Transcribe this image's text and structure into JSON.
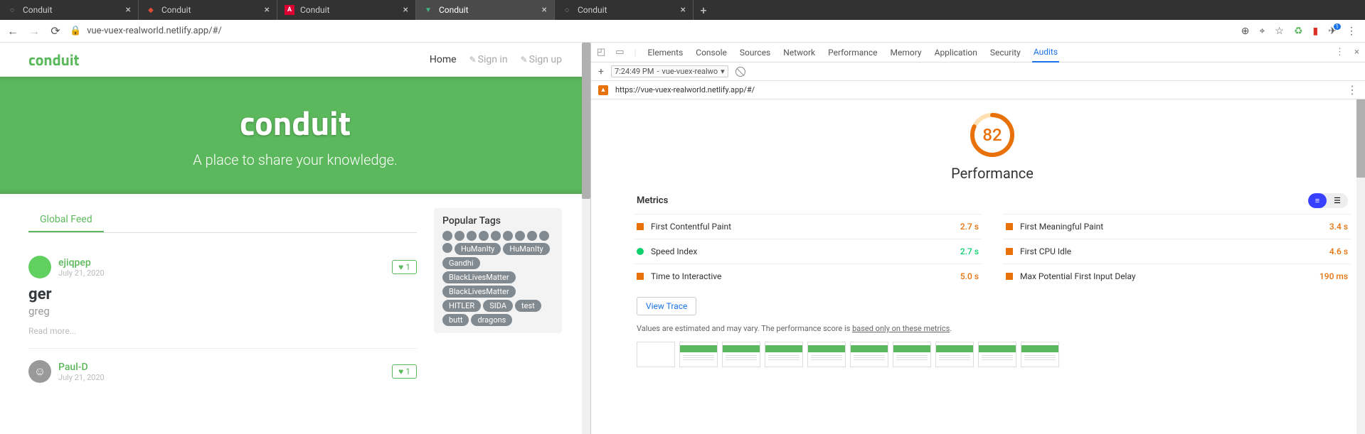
{
  "browser": {
    "tabs": [
      {
        "title": "Conduit",
        "favicon": "generic"
      },
      {
        "title": "Conduit",
        "favicon": "ember"
      },
      {
        "title": "Conduit",
        "favicon": "angular"
      },
      {
        "title": "Conduit",
        "favicon": "vue",
        "active": true
      },
      {
        "title": "Conduit",
        "favicon": "generic"
      }
    ],
    "url": "vue-vuex-realworld.netlify.app/#/"
  },
  "page": {
    "brand": "conduit",
    "nav": {
      "home": "Home",
      "signin": "Sign in",
      "signup": "Sign up"
    },
    "banner": {
      "title": "conduit",
      "subtitle": "A place to share your knowledge."
    },
    "feed_tab": "Global Feed",
    "articles": [
      {
        "author": "ejiqpep",
        "date": "July 21, 2020",
        "likes": "1",
        "title": "ger",
        "desc": "greg",
        "readmore": "Read more..."
      },
      {
        "author": "Paul-D",
        "date": "July 21, 2020",
        "likes": "1"
      }
    ],
    "tags": {
      "header": "Popular Tags",
      "blank_count": 10,
      "list": [
        "HuManIty",
        "HuManIty",
        "Gandhi",
        "BlackLivesMatter",
        "BlackLivesMatter",
        "HITLER",
        "SIDA",
        "test",
        "butt",
        "dragons"
      ]
    }
  },
  "devtools": {
    "panels": [
      "Elements",
      "Console",
      "Sources",
      "Network",
      "Performance",
      "Memory",
      "Application",
      "Security",
      "Audits"
    ],
    "active_panel": "Audits",
    "run": {
      "time": "7:24:49 PM",
      "name": "vue-vuex-realwo"
    },
    "audit_url": "https://vue-vuex-realworld.netlify.app/#/",
    "score": "82",
    "score_label": "Performance",
    "metrics_label": "Metrics",
    "metrics": [
      {
        "name": "First Contentful Paint",
        "value": "2.7 s",
        "status": "avg"
      },
      {
        "name": "First Meaningful Paint",
        "value": "3.4 s",
        "status": "avg"
      },
      {
        "name": "Speed Index",
        "value": "2.7 s",
        "status": "good"
      },
      {
        "name": "First CPU Idle",
        "value": "4.6 s",
        "status": "avg"
      },
      {
        "name": "Time to Interactive",
        "value": "5.0 s",
        "status": "avg"
      },
      {
        "name": "Max Potential First Input Delay",
        "value": "190 ms",
        "status": "avg"
      }
    ],
    "view_trace": "View Trace",
    "disclaimer_pre": "Values are estimated and may vary. The performance score is ",
    "disclaimer_link": "based only on these metrics",
    "disclaimer_post": "."
  }
}
